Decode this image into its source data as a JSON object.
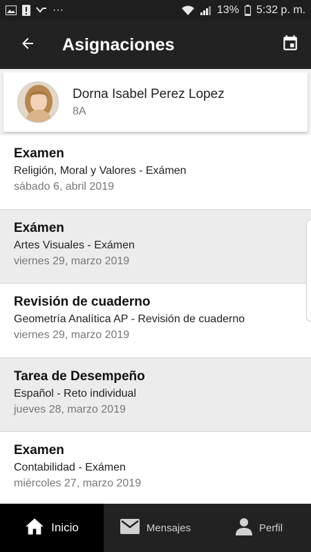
{
  "status_bar": {
    "battery_percent": "13%",
    "time": "5:32 p. m.",
    "more_dots": "···"
  },
  "header": {
    "title": "Asignaciones"
  },
  "profile": {
    "name": "Dorna Isabel Perez Lopez",
    "group": "8A"
  },
  "assignments": [
    {
      "title": "Examen",
      "subject": "Religión, Moral y Valores - Exámen",
      "date": "sábado 6, abril 2019"
    },
    {
      "title": "Exámen",
      "subject": "Artes Visuales - Exámen",
      "date": "viernes 29, marzo 2019"
    },
    {
      "title": "Revisión de cuaderno",
      "subject": "Geometría Analítica AP - Revisión de cuaderno",
      "date": "viernes 29, marzo 2019"
    },
    {
      "title": "Tarea de Desempeño",
      "subject": "Español - Reto individual",
      "date": "jueves 28, marzo 2019"
    },
    {
      "title": "Examen",
      "subject": "Contabilidad - Exámen",
      "date": "miércoles 27, marzo 2019"
    }
  ],
  "bottom_nav": {
    "home": "Inicio",
    "messages": "Mensajes",
    "profile": "Perfil"
  },
  "colors": {
    "app_bar": "#222222",
    "alt_row": "#ececec",
    "active_nav": "#000000"
  }
}
